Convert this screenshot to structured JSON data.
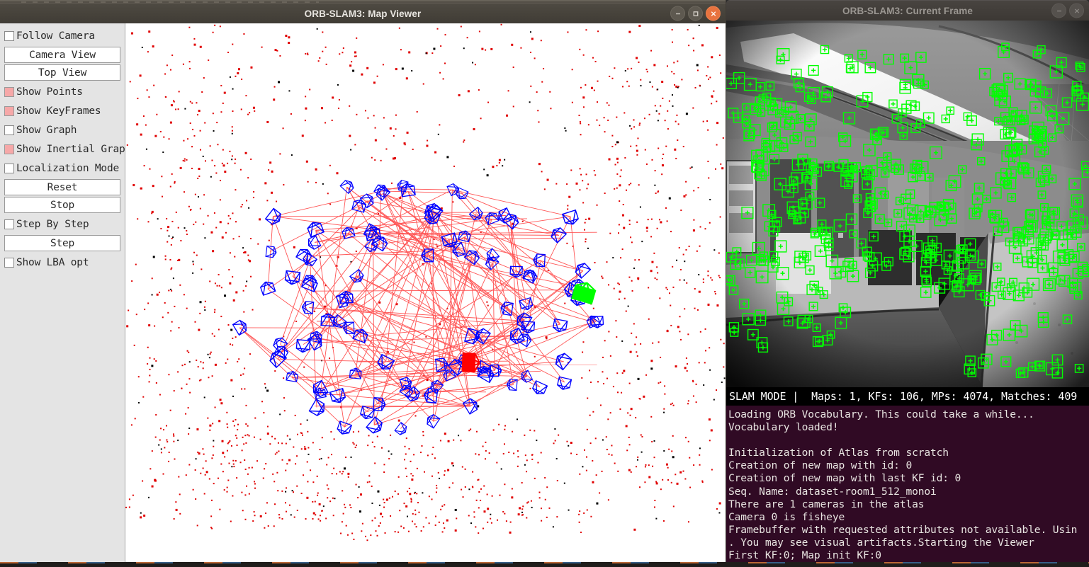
{
  "map_window": {
    "title": "ORB-SLAM3: Map Viewer",
    "buttons": {
      "minimize": "minimize",
      "maximize": "maximize",
      "close": "close"
    },
    "sidebar": {
      "controls": [
        {
          "type": "checkbox",
          "label": "Follow Camera",
          "checked": false
        },
        {
          "type": "button",
          "label": "Camera View"
        },
        {
          "type": "button",
          "label": "Top View"
        },
        {
          "type": "checkbox",
          "label": "Show Points",
          "checked": true
        },
        {
          "type": "checkbox",
          "label": "Show KeyFrames",
          "checked": true
        },
        {
          "type": "checkbox",
          "label": "Show Graph",
          "checked": false
        },
        {
          "type": "checkbox",
          "label": "Show Inertial Graph",
          "checked": true
        },
        {
          "type": "checkbox",
          "label": "Localization Mode",
          "checked": false
        },
        {
          "type": "button",
          "label": "Reset"
        },
        {
          "type": "button",
          "label": "Stop"
        },
        {
          "type": "checkbox",
          "label": "Step By Step",
          "checked": false
        },
        {
          "type": "button",
          "label": "Step"
        },
        {
          "type": "checkbox",
          "label": "Show LBA opt",
          "checked": false
        }
      ]
    },
    "viewer": {
      "colors": {
        "map_point": "#e00000",
        "map_point_reference": "#000000",
        "keyframe": "#0000ff",
        "graph_edge": "#ff5555",
        "current_camera": "#00ff00",
        "trajectory_camera": "#ff0000",
        "background": "#ffffff"
      }
    }
  },
  "frame_window": {
    "title": "ORB-SLAM3: Current Frame",
    "buttons": {
      "minimize": "minimize",
      "close": "close"
    },
    "feature_color": "#00ff00",
    "status": "SLAM MODE |  Maps: 1, KFs: 106, MPs: 4074, Matches: 409",
    "status_fields": {
      "mode": "SLAM MODE",
      "maps": 1,
      "kfs": 106,
      "mps": 4074,
      "matches": 409
    }
  },
  "terminal": {
    "lines": [
      "Loading ORB Vocabulary. This could take a while...",
      "Vocabulary loaded!",
      "",
      "Initialization of Atlas from scratch",
      "Creation of new map with id: 0",
      "Creation of new map with last KF id: 0",
      "Seq. Name: dataset-room1_512_monoi",
      "There are 1 cameras in the atlas",
      "Camera 0 is fisheye",
      "Framebuffer with requested attributes not available. Usin",
      ". You may see visual artifacts.Starting the Viewer",
      "First KF:0; Map init KF:0"
    ]
  },
  "taskbar": {
    "text": "clipped taskbar"
  }
}
